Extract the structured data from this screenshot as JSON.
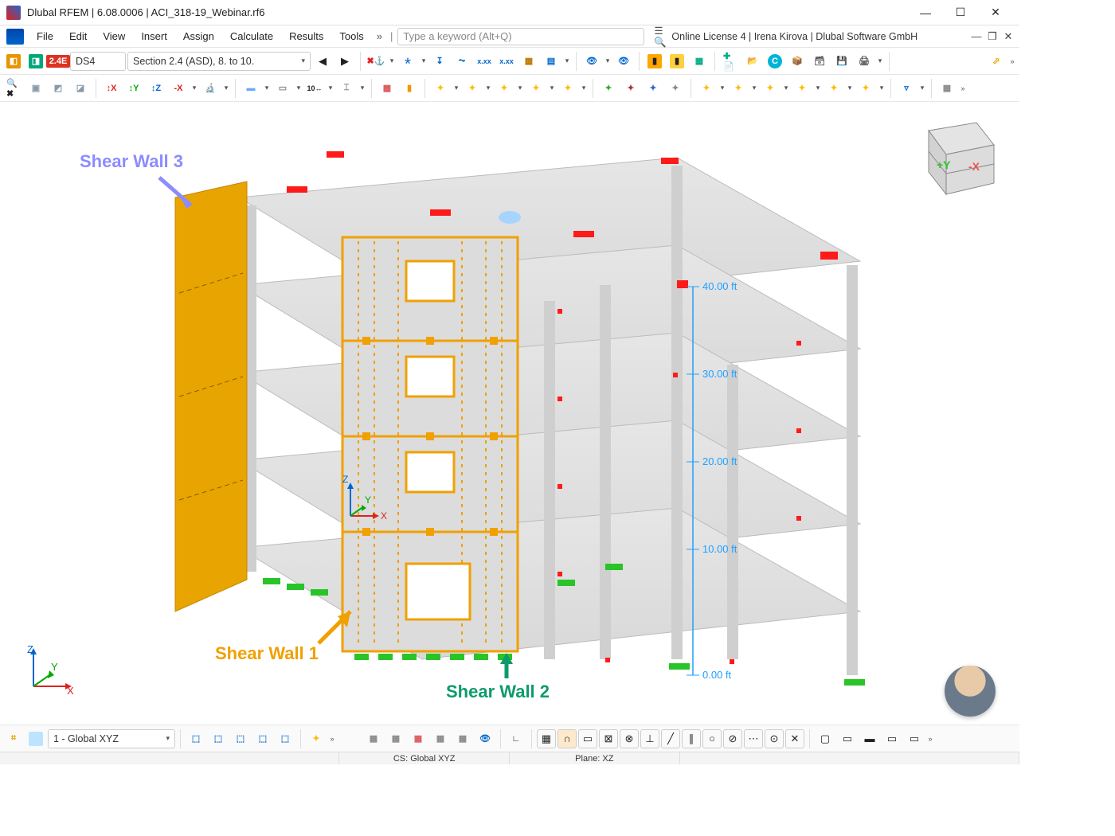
{
  "window": {
    "title": "Dlubal RFEM | 6.08.0006 | ACI_318-19_Webinar.rf6"
  },
  "menu": {
    "items": [
      "File",
      "Edit",
      "View",
      "Insert",
      "Assign",
      "Calculate",
      "Results",
      "Tools"
    ],
    "overflow_glyph": "»",
    "search_placeholder": "Type a keyword (Alt+Q)",
    "license_text": "Online License 4 | Irena Kirova | Dlubal Software GmbH"
  },
  "toolbar1": {
    "load_badge": "2.4E",
    "load_name": "DS4",
    "section_combo": "Section 2.4 (ASD), 8. to 10."
  },
  "bottom": {
    "view_combo": "1 - Global XYZ"
  },
  "status": {
    "cs": "CS: Global XYZ",
    "plane": "Plane: XZ"
  },
  "model": {
    "annotations": {
      "wall3": "Shear Wall 3",
      "wall1": "Shear Wall 1",
      "wall2": "Shear Wall 2"
    },
    "dims": [
      "40.00 ft",
      "30.00 ft",
      "20.00 ft",
      "10.00 ft",
      "0.00 ft"
    ],
    "axis_labels": {
      "x": "X",
      "y": "Y",
      "z": "Z"
    }
  },
  "navcube": {
    "yplus": "+Y",
    "xminus": "-X"
  }
}
